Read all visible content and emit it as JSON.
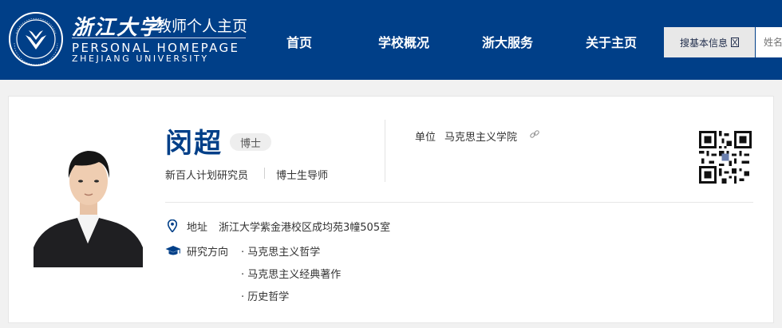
{
  "header": {
    "logo_cn": "浙江大学",
    "logo_subtitle": "教师个人主页",
    "logo_en_line1": "PERSONAL HOMEPAGE",
    "logo_en_line2": "ZHEJIANG UNIVERSITY",
    "seal_text": "ZHEJIANG UNIVERSITY 1897",
    "nav": [
      {
        "label": "首页"
      },
      {
        "label": "学校概况"
      },
      {
        "label": "浙大服务"
      },
      {
        "label": "关于主页"
      }
    ],
    "search": {
      "button_label": "搜基本信息",
      "button_icon": "search-dropdown-icon",
      "placeholder": "姓名"
    }
  },
  "profile": {
    "name": "闵超",
    "degree": "博士",
    "titles": [
      "新百人计划研究员",
      "博士生导师"
    ],
    "unit_label": "单位",
    "unit_value": "马克思主义学院",
    "address_label": "地址",
    "address_value": "浙江大学紫金港校区成均苑3幢505室",
    "research_label": "研究方向",
    "research_items": [
      "· 马克思主义哲学",
      "· 马克思主义经典著作",
      "· 历史哲学"
    ]
  },
  "colors": {
    "brand_blue": "#003f88",
    "page_bg": "#f1f1f1",
    "card_bg": "#ffffff"
  }
}
